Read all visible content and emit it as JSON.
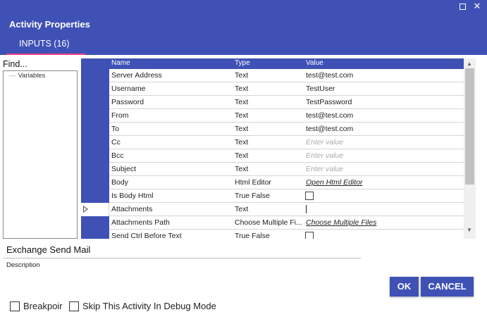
{
  "window": {
    "maximize_icon": "maximize-icon",
    "close_icon": "close-icon",
    "close_glyph": "✕"
  },
  "header": {
    "title": "Activity Properties",
    "tab": "INPUTS (16)",
    "accent": "#3f51b5",
    "tab_underline": "#ff4081"
  },
  "sidebar": {
    "find_label": "Find...",
    "tree_items": [
      "Variables"
    ]
  },
  "grid": {
    "columns": [
      "Name",
      "Type",
      "Value"
    ],
    "rows": [
      {
        "name": "Server Address",
        "type": "Text",
        "value": "test@test.com"
      },
      {
        "name": "Username",
        "type": "Text",
        "value": "TestUser"
      },
      {
        "name": "Password",
        "type": "Text",
        "value": "TestPassword"
      },
      {
        "name": "From",
        "type": "Text",
        "value": "test@test.com"
      },
      {
        "name": "To",
        "type": "Text",
        "value": "test@test.com"
      },
      {
        "name": "Cc",
        "type": "Text",
        "value": "Enter value"
      },
      {
        "name": "Bcc",
        "type": "Text",
        "value": "Enter value"
      },
      {
        "name": "Subject",
        "type": "Text",
        "value": "Enter value"
      },
      {
        "name": "Body",
        "type": "Html Editor",
        "value": "Open Html Editor"
      },
      {
        "name": "Is Body Html",
        "type": "True False",
        "value": ""
      },
      {
        "name": "Attachments",
        "type": "Text",
        "value": ""
      },
      {
        "name": "Attachments Path",
        "type": "Choose Multiple Fi...",
        "value": "Choose Multiple Files"
      },
      {
        "name": "Send Ctrl Before Text",
        "type": "True False",
        "value": ""
      }
    ]
  },
  "footer": {
    "activity_name": "Exchange Send Mail",
    "description_label": "Description",
    "ok_label": "OK",
    "cancel_label": "CANCEL",
    "breakpoint_label": "Breakpoir",
    "skip_label": "Skip This Activity In Debug Mode"
  }
}
